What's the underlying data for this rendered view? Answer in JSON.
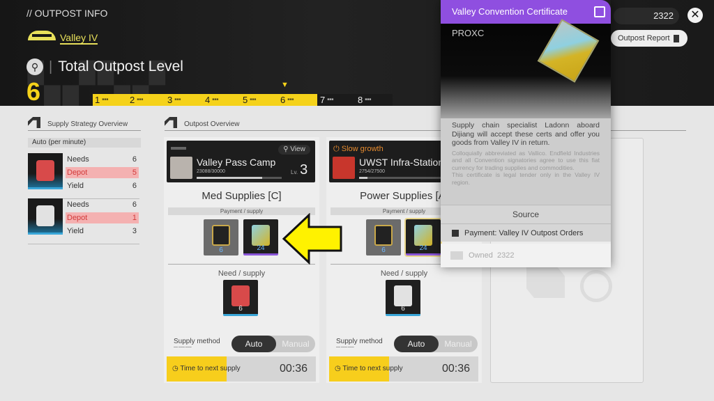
{
  "header": {
    "breadcrumb": "// OUTPOST INFO",
    "region": "Valley IV",
    "title": "Total Outpost Level",
    "separator": "|",
    "current_level": "6",
    "level_marks": [
      "1",
      "2",
      "3",
      "4",
      "5",
      "6",
      "7",
      "8"
    ],
    "level_reached": 6,
    "currency_count": "2322",
    "report_button": "Outpost Report",
    "close_symbol": "✕"
  },
  "strategy": {
    "title": "Supply Strategy Overview",
    "mode": "Auto (per minute)",
    "items": [
      {
        "needs_label": "Needs",
        "needs": "6",
        "depot_label": "Depot",
        "depot": "5",
        "yield_label": "Yield",
        "yield": "6",
        "color": "#d84a4a"
      },
      {
        "needs_label": "Needs",
        "needs": "6",
        "depot_label": "Depot",
        "depot": "1",
        "yield_label": "Yield",
        "yield": "3",
        "color": "#e2e2e2"
      }
    ]
  },
  "overview": {
    "title": "Outpost Overview",
    "cards": [
      {
        "status": "",
        "view": "View",
        "name": "Valley Pass Camp",
        "progress_text": "23088/30000",
        "progress": 0.7696,
        "level_label": "Lv.",
        "level": "3",
        "goods": "Med Supplies [C]",
        "payment_label": "Payment / supply",
        "payment_items": [
          {
            "qty": "6"
          },
          {
            "qty": "24"
          }
        ],
        "need_label": "Need / supply",
        "need_qty": "6",
        "supply_method": "Supply method",
        "auto": "Auto",
        "manual": "Manual",
        "timer_label": "Time to next supply",
        "timer_value": "00:36",
        "timer_fill": 0.4
      },
      {
        "status": "Slow growth",
        "view": "",
        "name": "UWST Infra-Station",
        "progress_text": "2754/27500",
        "progress": 0.1,
        "level_label": "",
        "level": "",
        "goods": "Power Supplies [A]",
        "payment_label": "Payment / supply",
        "payment_items": [
          {
            "qty": "6"
          },
          {
            "qty": "24"
          }
        ],
        "need_label": "Need / supply",
        "need_qty": "6",
        "supply_method": "Supply method",
        "auto": "Auto",
        "manual": "Manual",
        "timer_label": "Time to next supply",
        "timer_value": "00:36",
        "timer_fill": 0.4
      }
    ]
  },
  "tooltip": {
    "title": "Valley Convention Certificate",
    "code": "PROXC",
    "description": "Supply chain specialist Ladonn aboard Dijiang will accept these certs and offer you goods from Valley IV in return.",
    "lore": "Colloquially abbreviated as Vallico. Endfield Industries and all Convention signatories agree to use this fiat currency for trading supplies and commodities.",
    "lore2": "This certificate is legal tender only in the Valley IV region.",
    "source_label": "Source",
    "source": "Payment: Valley IV Outpost Orders",
    "owned_label": "Owned",
    "owned": "2322"
  },
  "colors": {
    "accent": "#f5d21a",
    "tooltip": "#8f4fe0",
    "depot": "#f4b1b1"
  }
}
